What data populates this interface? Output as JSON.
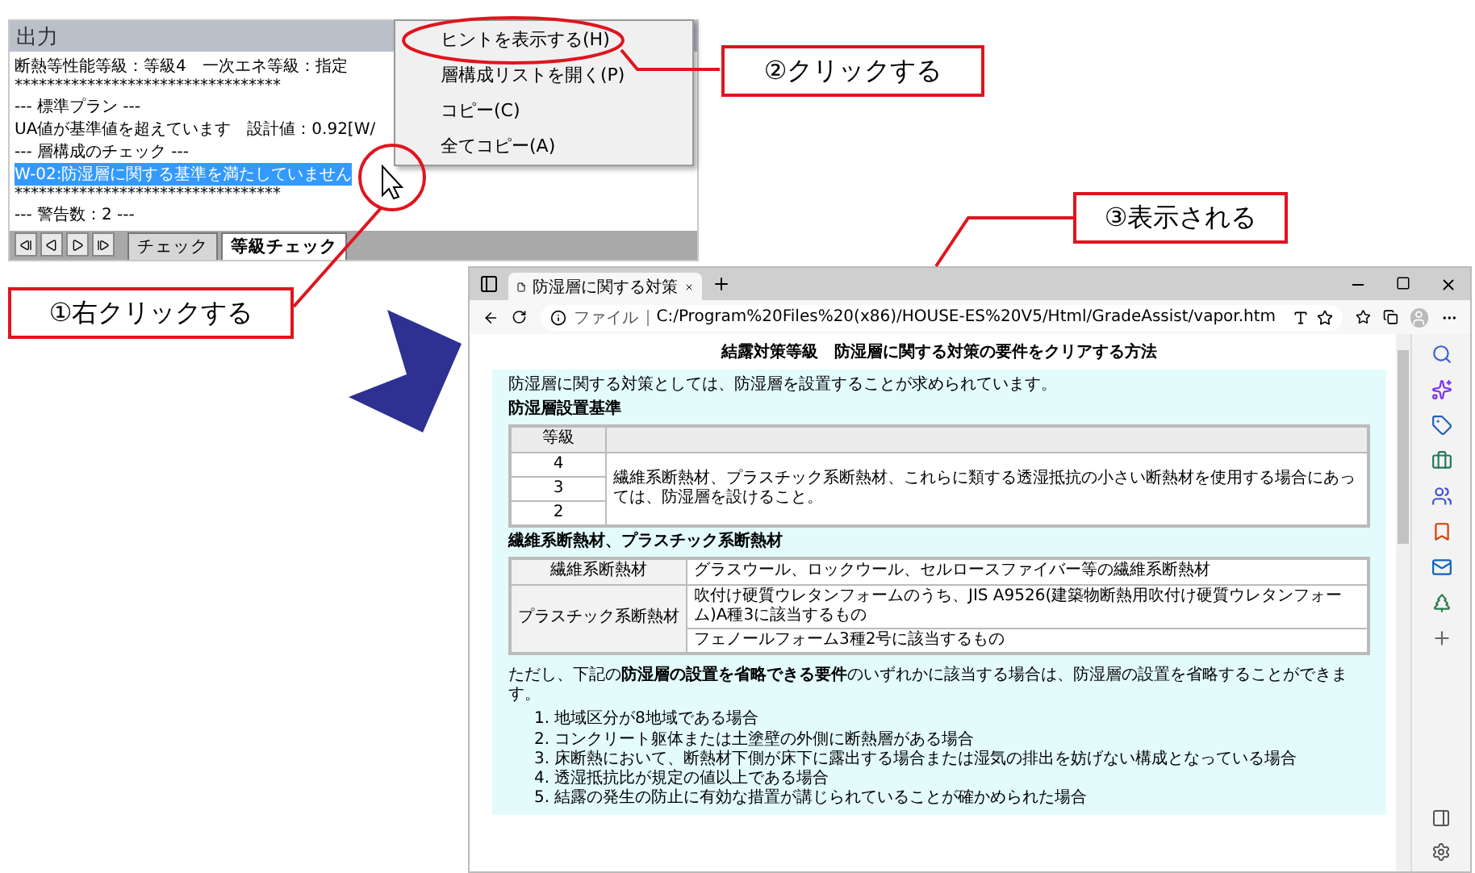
{
  "output_panel": {
    "title": "出力",
    "lines": [
      {
        "text": "断熱等性能等級：等級4　一次エネ等級：指定",
        "selected": false
      },
      {
        "text": "*********************************",
        "selected": false
      },
      {
        "text": "--- 標準プラン ---",
        "selected": false
      },
      {
        "text": "UA値が基準値を超えています　設計値：0.92[W/",
        "selected": false
      },
      {
        "text": "--- 層構成のチェック ---",
        "selected": false
      },
      {
        "text": "W-02:防湿層に関する基準を満たしていません",
        "selected": true
      },
      {
        "text": "*********************************",
        "selected": false
      },
      {
        "text": "--- 警告数：2 ---",
        "selected": false
      }
    ],
    "tabs": [
      {
        "label": "チェック",
        "selected": false
      },
      {
        "label": "等級チェック",
        "selected": true
      }
    ]
  },
  "context_menu": {
    "items": [
      {
        "label": "ヒントを表示する(H)"
      },
      {
        "label": "層構成リストを開く(P)"
      },
      {
        "label": "コピー(C)"
      },
      {
        "label": "全てコピー(A)"
      }
    ]
  },
  "callouts": [
    {
      "text": "②クリックする"
    },
    {
      "text": "③表示される"
    },
    {
      "text": "①右クリックする"
    }
  ],
  "browser": {
    "tab_title": "防湿層に関する対策",
    "address_label": "ファイル",
    "url": "C:/Program%20Files%20(x86)/HOUSE-ES%20V5/Html/GradeAssist/vapor.htm",
    "page": {
      "title": "結露対策等級　防湿層に関する対策の要件をクリアする方法",
      "intro": "防湿層に関する対策としては、防湿層を設置することが求められています。",
      "standard": {
        "heading": "防湿層設置基準",
        "column": "等級",
        "grades": [
          "4",
          "3",
          "2"
        ],
        "requirement": "繊維系断熱材、プラスチック系断熱材、これらに類する透湿抵抗の小さい断熱材を使用する場合にあっては、防湿層を設けること。"
      },
      "materials": {
        "heading": "繊維系断熱材、プラスチック系断熱材",
        "rows": [
          {
            "category": "繊維系断熱材",
            "items": [
              "グラスウール、ロックウール、セルロースファイバー等の繊維系断熱材"
            ]
          },
          {
            "category": "プラスチック系断熱材",
            "items": [
              "吹付け硬質ウレタンフォームのうち、JIS A9526(建築物断熱用吹付け硬質ウレタンフォーム)A種3に該当するもの",
              "フェノールフォーム3種2号に該当するもの"
            ]
          }
        ]
      },
      "note": "ただし、下記の**防湿層の設置を省略できる要件**のいずれかに該当する場合は、防湿層の設置を省略することができます。",
      "conditions": [
        {
          "number": "1.",
          "text": "地域区分が8地域である場合"
        },
        {
          "number": "2.",
          "text": "コンクリート躯体または土塗壁の外側に断熱層がある場合"
        },
        {
          "number": "3.",
          "text": "床断熱において、断熱材下側が床下に露出する場合または湿気の排出を妨げない構成となっている場合"
        },
        {
          "number": "4.",
          "text": "透湿抵抗比が規定の値以上である場合"
        },
        {
          "number": "5.",
          "text": "結露の発生の防止に有効な措置が講じられていることが確かめられた場合"
        }
      ]
    }
  }
}
